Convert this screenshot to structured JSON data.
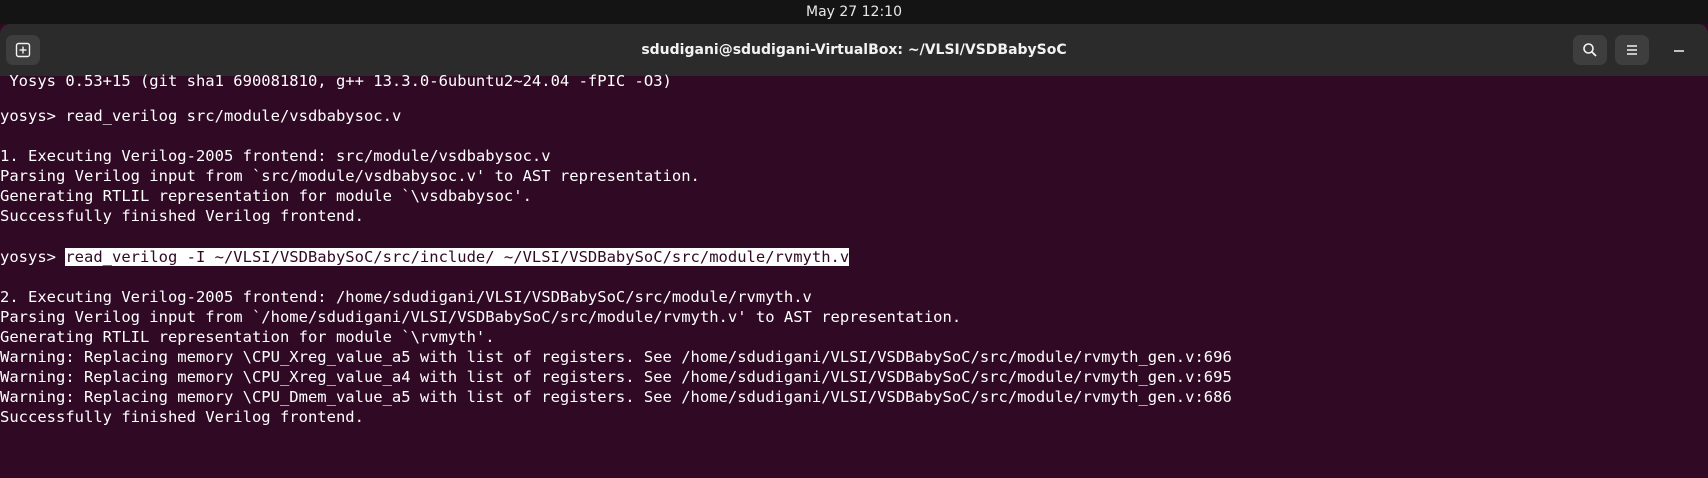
{
  "topbar": {
    "datetime": "May 27  12:10"
  },
  "window": {
    "title": "sdudigani@sdudigani-VirtualBox: ~/VLSI/VSDBabySoC"
  },
  "icons": {
    "new_tab": "new-tab-icon",
    "search": "search-icon",
    "menu": "hamburger-menu-icon",
    "minimize": "minimize-icon"
  },
  "colors": {
    "terminal_bg": "#300a24",
    "terminal_fg": "#ffffff",
    "titlebar_bg": "#2b2b2b",
    "topbar_bg": "#141414"
  },
  "terminal": {
    "line_0": " Yosys 0.53+15 (git sha1 690081810, g++ 13.3.0-6ubuntu2~24.04 -fPIC -O3)",
    "prompt_1": "yosys> ",
    "cmd_1": "read_verilog src/module/vsdbabysoc.v",
    "line_3": "1. Executing Verilog-2005 frontend: src/module/vsdbabysoc.v",
    "line_4": "Parsing Verilog input from `src/module/vsdbabysoc.v' to AST representation.",
    "line_5": "Generating RTLIL representation for module `\\vsdbabysoc'.",
    "line_6": "Successfully finished Verilog frontend.",
    "prompt_2": "yosys> ",
    "cmd_2": "read_verilog -I ~/VLSI/VSDBabySoC/src/include/ ~/VLSI/VSDBabySoC/src/module/rvmyth.v",
    "line_10": "2. Executing Verilog-2005 frontend: /home/sdudigani/VLSI/VSDBabySoC/src/module/rvmyth.v",
    "line_11": "Parsing Verilog input from `/home/sdudigani/VLSI/VSDBabySoC/src/module/rvmyth.v' to AST representation.",
    "line_12": "Generating RTLIL representation for module `\\rvmyth'.",
    "line_13": "Warning: Replacing memory \\CPU_Xreg_value_a5 with list of registers. See /home/sdudigani/VLSI/VSDBabySoC/src/module/rvmyth_gen.v:696",
    "line_14": "Warning: Replacing memory \\CPU_Xreg_value_a4 with list of registers. See /home/sdudigani/VLSI/VSDBabySoC/src/module/rvmyth_gen.v:695",
    "line_15": "Warning: Replacing memory \\CPU_Dmem_value_a5 with list of registers. See /home/sdudigani/VLSI/VSDBabySoC/src/module/rvmyth_gen.v:686",
    "line_16": "Successfully finished Verilog frontend."
  }
}
